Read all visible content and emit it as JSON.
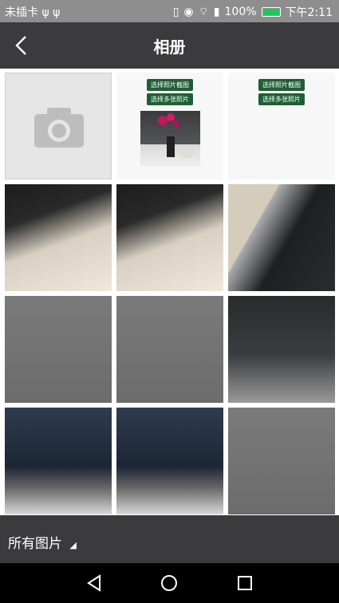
{
  "status_bar": {
    "carrier": "未插卡",
    "battery_percent": "100%",
    "time": "下午2:11"
  },
  "header": {
    "title": "相册"
  },
  "grid": {
    "camera_tile_icon": "camera-icon",
    "photo_tile": {
      "button_1": "选择照片截图",
      "button_2": "选择多张照片"
    },
    "white_tile": {
      "button_1": "选择照片截图",
      "button_2": "选择多张照片"
    }
  },
  "bottom_bar": {
    "album_label": "所有图片",
    "dropdown_icon": "triangle-up-icon"
  },
  "nav_bar": {
    "back_icon": "triangle-back-icon",
    "home_icon": "circle-home-icon",
    "recents_icon": "square-recents-icon"
  }
}
